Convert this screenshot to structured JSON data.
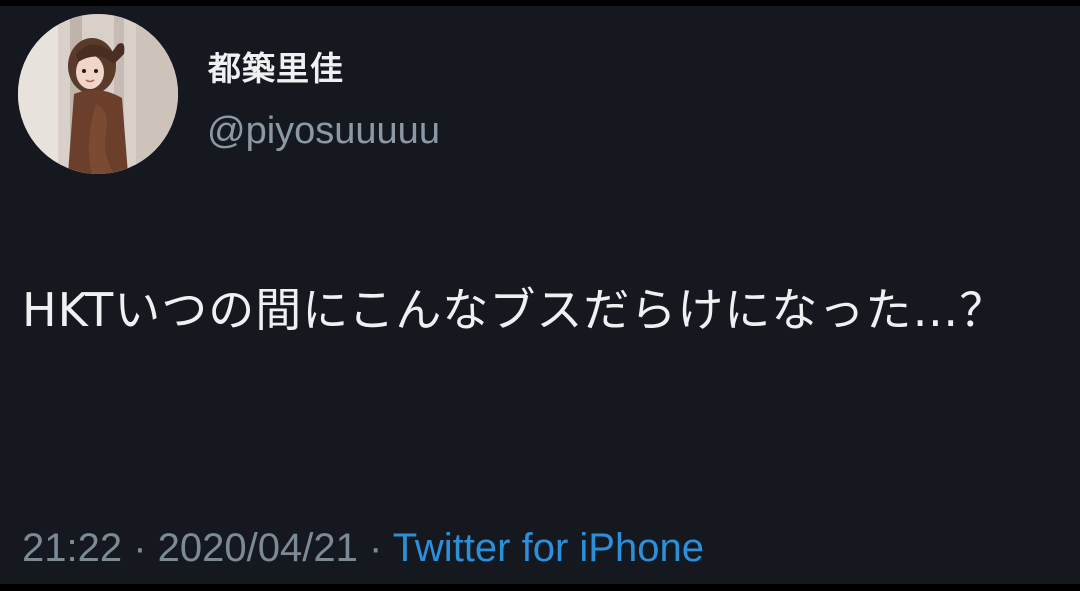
{
  "tweet": {
    "display_name": "都築里佳",
    "handle": "@piyosuuuuu",
    "text": "HKTいつの間にこんなブスだらけになった…？",
    "time": "21:22",
    "separator": " · ",
    "date": "2020/04/21",
    "source": "Twitter for iPhone"
  },
  "colors": {
    "background": "#15181f",
    "link": "#2c8fd9",
    "secondary_text": "#8b98a5"
  },
  "icons": {
    "avatar": "profile-photo"
  }
}
